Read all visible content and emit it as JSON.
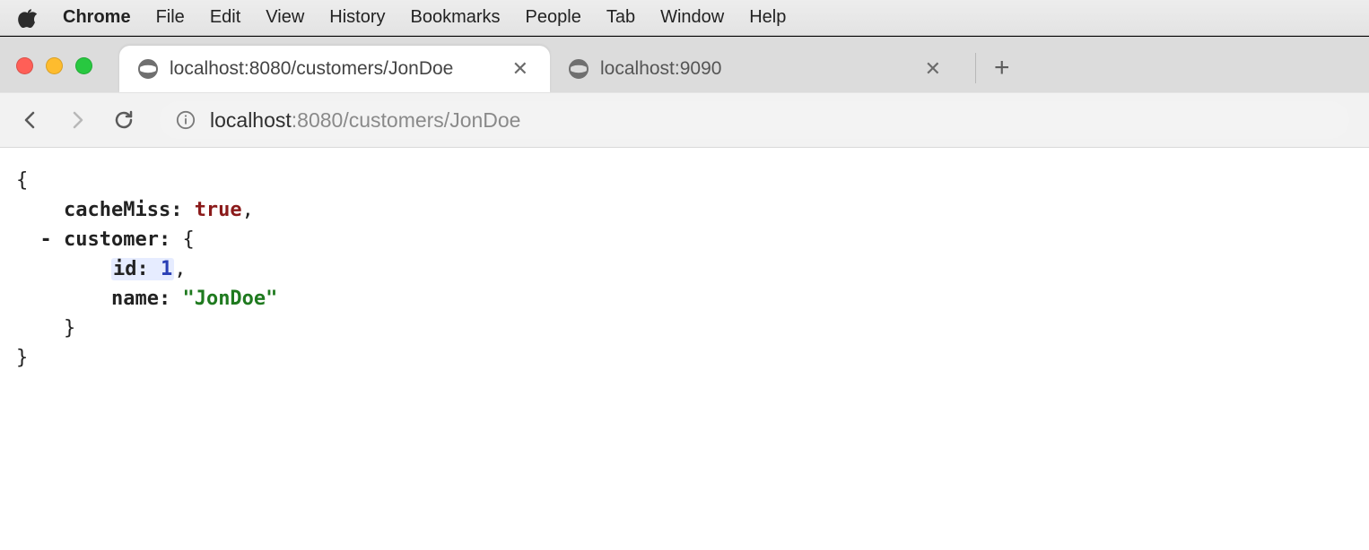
{
  "menubar": {
    "app_name": "Chrome",
    "items": [
      "File",
      "Edit",
      "View",
      "History",
      "Bookmarks",
      "People",
      "Tab",
      "Window",
      "Help"
    ]
  },
  "tabs": {
    "active": {
      "title": "localhost:8080/customers/JonDoe"
    },
    "inactive": {
      "title": "localhost:9090"
    }
  },
  "address_bar": {
    "host": "localhost",
    "path": ":8080/customers/JonDoe"
  },
  "json_view": {
    "brace_open": "{",
    "brace_close": "}",
    "cacheMiss_key": "cacheMiss:",
    "cacheMiss_value": "true",
    "comma": ",",
    "collapse_symbol": "-",
    "customer_key": "customer:",
    "customer_open": "{",
    "id_key": "id:",
    "id_value": "1",
    "name_key": "name:",
    "name_value": "\"JonDoe\"",
    "customer_close": "}"
  }
}
